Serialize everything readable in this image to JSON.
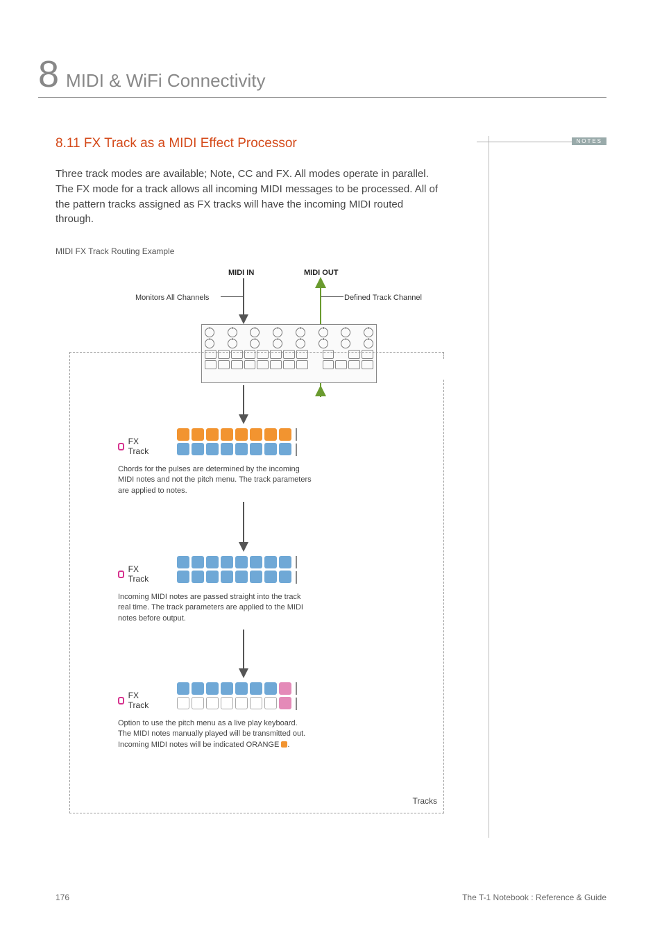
{
  "chapter": {
    "number": "8",
    "title": "MIDI & WiFi Connectivity"
  },
  "section": {
    "heading": "8.11 FX Track as a MIDI Effect Processor",
    "body": "Three track modes are available; Note, CC and FX. All modes operate in parallel. The FX mode for a track allows all incoming MIDI messages to be processed. All of the pattern tracks assigned as FX tracks will have the incoming MIDI routed through."
  },
  "notes_label": "NOTES",
  "diagram": {
    "example_label": "MIDI FX Track Routing Example",
    "midi_in": "MIDI IN",
    "midi_out": "MIDI OUT",
    "monitors": "Monitors All Channels",
    "defined": "Defined Track Channel",
    "tracks_label": "Tracks",
    "fx_track": "FX Track",
    "desc1": "Chords for the pulses are determined by the incoming MIDI notes and not the pitch menu. The track parameters are applied to notes.",
    "desc2": "Incoming MIDI notes are passed straight into the track real time. The track parameters are applied to the MIDI notes before output.",
    "desc3_a": "Option to use the pitch menu as a live play keyboard. The MIDI notes manually played will be transmitted out. Incoming MIDI notes will be indicated ORANGE ",
    "desc3_b": "."
  },
  "footer": {
    "page": "176",
    "book": "The T-1 Notebook : Reference & Guide"
  }
}
